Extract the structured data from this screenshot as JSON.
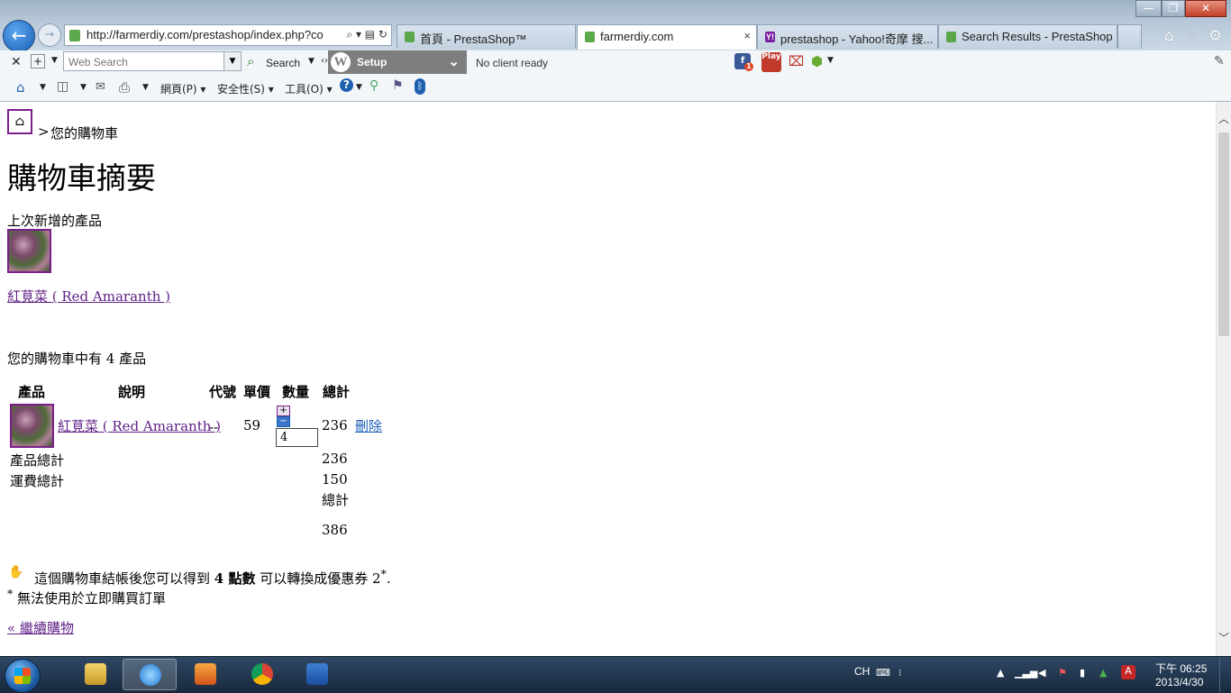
{
  "browser": {
    "url": "http://farmerdiy.com/prestashop/index.php?co",
    "tabs": [
      {
        "label": "首頁 - PrestaShop™",
        "active": false
      },
      {
        "label": "farmerdiy.com",
        "active": true
      },
      {
        "label": "prestashop - Yahoo!奇摩 搜...",
        "active": false
      },
      {
        "label": "Search Results - PrestaShop ...",
        "active": false
      }
    ],
    "tab_close": "×",
    "back_glyph": "←",
    "forward_glyph": "→"
  },
  "toolbar1": {
    "search_placeholder": "Web Search",
    "search_label": "Search",
    "setup_label": "Setup",
    "status_text": "No client ready",
    "play_badge": "Play",
    "fb_badge": "1"
  },
  "toolbar2": {
    "menu_page": "網頁(P)",
    "menu_safety": "安全性(S)",
    "menu_tools": "工具(O)"
  },
  "page": {
    "breadcrumb_separator": ">",
    "breadcrumb_current": "您的購物車",
    "title": "購物車摘要",
    "last_added_label": "上次新增的產品",
    "last_added_product": "紅莧菜 ( Red Amaranth )",
    "cart_count_text": "您的購物車中有 4 產品",
    "table": {
      "headers": [
        "產品",
        "說明",
        "代號",
        "單價",
        "數量",
        "總計"
      ],
      "rows": [
        {
          "name": "紅莧菜 ( Red Amaranth )",
          "code": "--",
          "unit_price": "59",
          "quantity": "4",
          "total": "236",
          "delete_label": "刪除"
        }
      ],
      "qty_plus": "+",
      "qty_minus": "−",
      "products_total_label": "產品總計",
      "products_total_value": "236",
      "shipping_total_label": "運費總計",
      "shipping_total_value": "150",
      "grand_total_label": "總計",
      "grand_total_value": "386"
    },
    "loyalty_prefix": "這個購物車結帳後您可以得到",
    "loyalty_points": "4 點數",
    "loyalty_suffix": "可以轉換成優惠券 2",
    "loyalty_end": ".",
    "asterisk": "*",
    "note_text": "無法使用於立即購買訂單",
    "continue_link": "« 繼續購物"
  },
  "taskbar": {
    "lang": "CH",
    "time": "下午 06:25",
    "date": "2013/4/30"
  },
  "colors": {
    "link_visited": "#5f1f86",
    "link_blue": "#1a5bb8",
    "taskbar": "#1f3550"
  }
}
